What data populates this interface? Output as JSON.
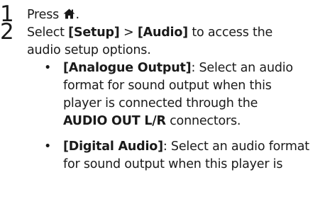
{
  "steps": [
    {
      "number": "1",
      "text_before": "Press",
      "icon": "home-icon",
      "text_after": "."
    },
    {
      "number": "2",
      "text_1": "Select",
      "setup": "[Setup]",
      "gt": ">",
      "audio": "[Audio]",
      "line1_tail": "to access the",
      "line2": "audio setup options."
    }
  ],
  "bullets": [
    {
      "dot": "•",
      "title": "[Analogue Output]",
      "line1_rest": ": Select an audio",
      "line2": "format for sound output when this",
      "line3": "player is connected through the",
      "connector": "AUDIO OUT L/R",
      "line4_tail": "connectors."
    },
    {
      "dot": "•",
      "title": "[Digital Audio]",
      "line1_rest": ": Select an audio format",
      "line2": "for sound output when this player is"
    }
  ]
}
